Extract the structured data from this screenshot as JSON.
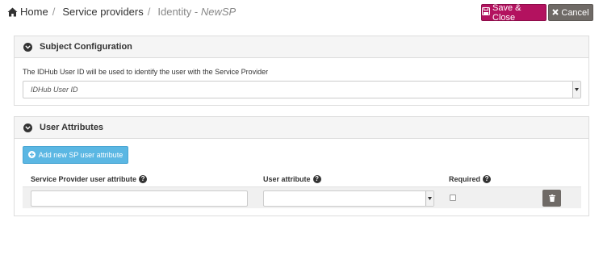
{
  "breadcrumb": {
    "home": "Home",
    "separator": "/",
    "service_providers": "Service providers",
    "current_prefix": "Identity - ",
    "current_name": "NewSP"
  },
  "toolbar": {
    "save_label": "Save & Close",
    "cancel_label": "Cancel"
  },
  "subject_configuration": {
    "title": "Subject Configuration",
    "description": "The IDHub User ID will be used to identify the user with the Service Provider",
    "selected_value": "IDHub User ID"
  },
  "user_attributes": {
    "title": "User Attributes",
    "add_button_label": "Add new SP user attribute",
    "columns": {
      "sp_attribute": "Service Provider user attribute",
      "user_attribute": "User attribute",
      "required": "Required"
    },
    "rows": [
      {
        "sp_attribute_value": "",
        "user_attribute_value": "",
        "required": false
      }
    ]
  },
  "colors": {
    "save": "#b3125f",
    "cancel": "#6f6a66",
    "add": "#5bb7e3",
    "panel_heading": "#f5f5f5"
  },
  "icons": {
    "home": "home-icon",
    "save": "floppy-disk-icon",
    "cancel": "close-icon",
    "chevron": "chevron-down-icon",
    "add": "plus-circle-icon",
    "help": "question-circle-icon",
    "delete": "trash-icon"
  }
}
